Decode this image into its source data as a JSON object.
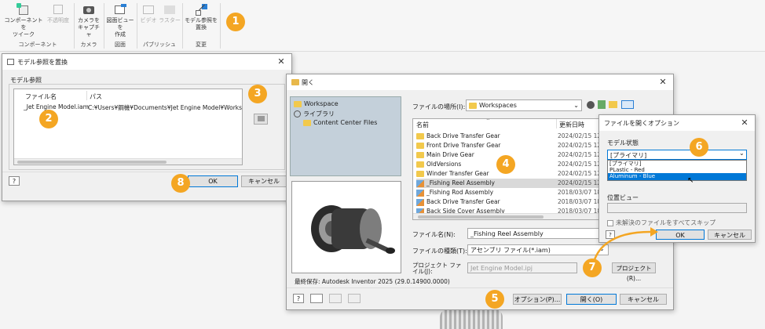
{
  "ribbon": {
    "buttons": [
      {
        "label": "コンポーネントを\nツイーク"
      },
      {
        "label": "不透明度"
      },
      {
        "label": "カメラを\nキャプチャ"
      },
      {
        "label": "図面ビューを\n作成"
      },
      {
        "label": "ビデオ"
      },
      {
        "label": "ラスター"
      },
      {
        "label": "モデル参照を\n置換"
      }
    ],
    "groups": [
      "コンポーネント",
      "カメラ",
      "図面",
      "パブリッシュ",
      "変更"
    ]
  },
  "replace_dialog": {
    "title": "モデル参照を置換",
    "section": "モデル参照",
    "col_file": "ファイル名",
    "col_path": "パス",
    "row_file": "_Jet Engine Model.iam",
    "row_path": "C:¥Users¥鋼機¥Documents¥Jet Engine Model¥Workspace",
    "ok": "OK",
    "cancel": "キャンセル"
  },
  "open_dialog": {
    "title": "開く",
    "tree": [
      "Workspace",
      "ライブラリ",
      "Content Center Files"
    ],
    "location_label": "ファイルの場所(I):",
    "location_value": "Workspaces",
    "col_name": "名前",
    "col_date": "更新日時",
    "files": [
      {
        "name": "Back Drive Transfer Gear",
        "date": "2024/02/15 12:",
        "type": "folder"
      },
      {
        "name": "Front Drive Transfer Gear",
        "date": "2024/02/15 12:",
        "type": "folder"
      },
      {
        "name": "Main Drive Gear",
        "date": "2024/02/15 12:",
        "type": "folder"
      },
      {
        "name": "OldVersions",
        "date": "2024/02/15 12:",
        "type": "folder"
      },
      {
        "name": "Winder Transfer Gear",
        "date": "2024/02/15 12:",
        "type": "folder"
      },
      {
        "name": "_Fishing Reel Assembly",
        "date": "2024/02/15 12:",
        "type": "asm"
      },
      {
        "name": "_Fishing Rod Assembly",
        "date": "2018/03/07 18:",
        "type": "asm"
      },
      {
        "name": "Back Drive Transfer Gear",
        "date": "2018/03/07 18:",
        "type": "asm"
      },
      {
        "name": "Back Side Cover Assembly",
        "date": "2018/03/07 18:",
        "type": "asm"
      }
    ],
    "filename_label": "ファイル名(N):",
    "filename_value": "_Fishing Reel Assembly",
    "filetype_label": "ファイルの種類(T):",
    "filetype_value": "アセンブリ ファイル(*.iam)",
    "project_label": "プロジェクト ファイル(J):",
    "project_value": "Jet Engine Model.ipj",
    "project_btn": "プロジェクト(R)...",
    "last_saved": "最終保存: Autodesk Inventor 2025 (29.0.14900.0000)",
    "options_btn": "オプション(P)...",
    "open_btn": "開く(O)",
    "cancel_btn": "キャンセル"
  },
  "options_dialog": {
    "title": "ファイルを開くオプション",
    "model_state_label": "モデル状態",
    "model_state_value": "[プライマリ]",
    "options": [
      "[プライマリ]",
      "PLastic - Red",
      "Aluminum - Blue"
    ],
    "position_label": "位置ビュー",
    "skip_label": "未解決のファイルをすべてスキップ",
    "ok": "OK",
    "cancel": "キャンセル"
  },
  "badges": [
    "1",
    "2",
    "3",
    "4",
    "5",
    "6",
    "7",
    "8"
  ],
  "colors": {
    "badge": "#f4a623",
    "selection": "#0078d7"
  }
}
